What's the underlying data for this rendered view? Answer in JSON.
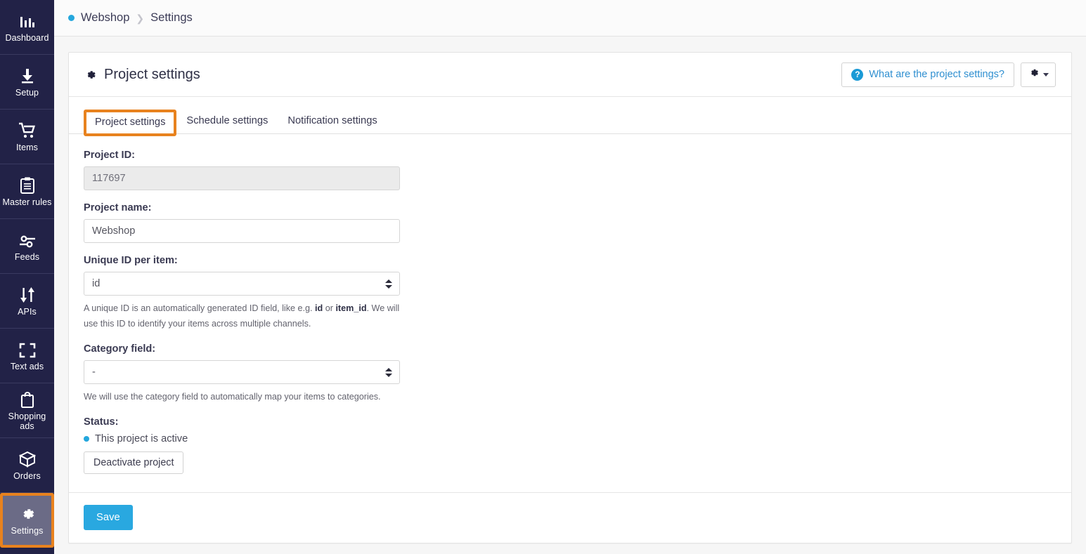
{
  "sidebar": {
    "items": [
      {
        "label": "Dashboard",
        "icon": "bar-chart-icon",
        "active": false
      },
      {
        "label": "Setup",
        "icon": "download-icon",
        "active": false
      },
      {
        "label": "Items",
        "icon": "shopping-cart-icon",
        "active": false
      },
      {
        "label": "Master rules",
        "icon": "clipboard-icon",
        "active": false
      },
      {
        "label": "Feeds",
        "icon": "sliders-icon",
        "active": false
      },
      {
        "label": "APIs",
        "icon": "arrows-up-down-icon",
        "active": false
      },
      {
        "label": "Text ads",
        "icon": "crop-frame-icon",
        "active": false
      },
      {
        "label": "Shopping ads",
        "icon": "shopping-bag-icon",
        "active": false
      },
      {
        "label": "Orders",
        "icon": "box-icon",
        "active": false
      },
      {
        "label": "Settings",
        "icon": "gear-icon",
        "active": true
      }
    ]
  },
  "breadcrumb": {
    "project": "Webshop",
    "separator": "❯",
    "current": "Settings"
  },
  "panel": {
    "title": "Project settings",
    "title_icon": "gear-icon",
    "help_button": {
      "label": "What are the project settings?",
      "icon": "question-circle-icon"
    },
    "options_button": {
      "icon": "gear-icon",
      "caret": "chevron-down-icon"
    }
  },
  "tabs": [
    {
      "label": "Project settings",
      "active": true
    },
    {
      "label": "Schedule settings",
      "active": false
    },
    {
      "label": "Notification settings",
      "active": false
    }
  ],
  "form": {
    "project_id": {
      "label": "Project ID:",
      "value": "117697",
      "placeholder": ""
    },
    "project_name": {
      "label": "Project name:",
      "value": "Webshop",
      "placeholder": ""
    },
    "unique_id": {
      "label": "Unique ID per item:",
      "value": "id",
      "options": [
        "id"
      ],
      "help_prefix": "A unique ID is an automatically generated ID field, like e.g. ",
      "help_bold_1": "id",
      "help_mid": " or ",
      "help_bold_2": "item_id",
      "help_suffix": ". We will use this ID to identify your items across multiple channels."
    },
    "category_field": {
      "label": "Category field:",
      "value": "-",
      "options": [
        "-"
      ],
      "help": "We will use the category field to automatically map your items to categories."
    },
    "status": {
      "label": "Status:",
      "text": "This project is active",
      "deactivate_label": "Deactivate project"
    }
  },
  "footer": {
    "save_label": "Save"
  },
  "colors": {
    "sidebar_bg": "#222247",
    "accent_blue": "#29a8e0",
    "highlight_orange": "#e8821e",
    "active_item_bg": "#6b6b86"
  }
}
